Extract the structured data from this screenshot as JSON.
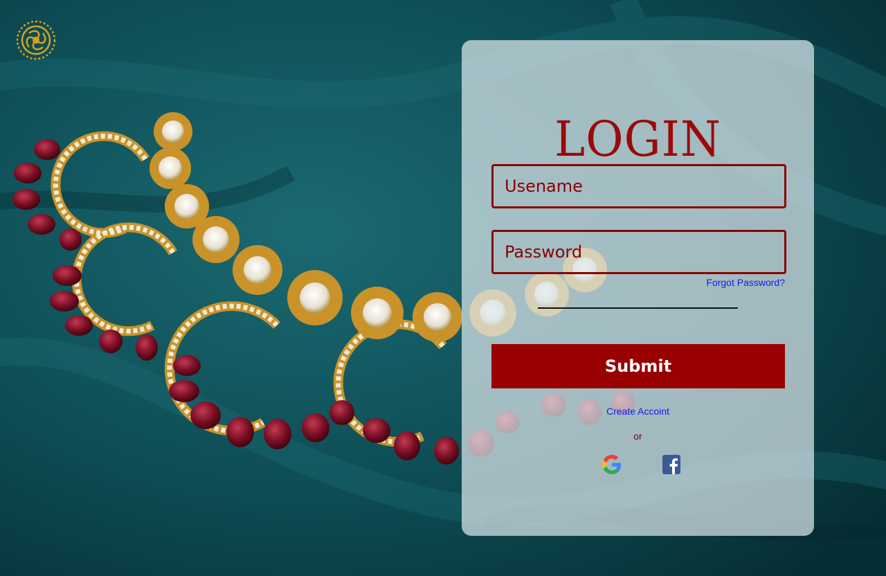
{
  "login": {
    "title": "LOGIN",
    "username_placeholder": "Usename",
    "password_placeholder": "Password",
    "forgot_password": "Forgot Password?",
    "submit_label": "Submit",
    "create_account": "Create Accoint",
    "or_text": "or"
  },
  "social": {
    "google_icon": "google-icon",
    "facebook_icon": "facebook-icon"
  },
  "colors": {
    "accent": "#990000",
    "link": "#1a1ae6",
    "background": "#0d4a52"
  }
}
